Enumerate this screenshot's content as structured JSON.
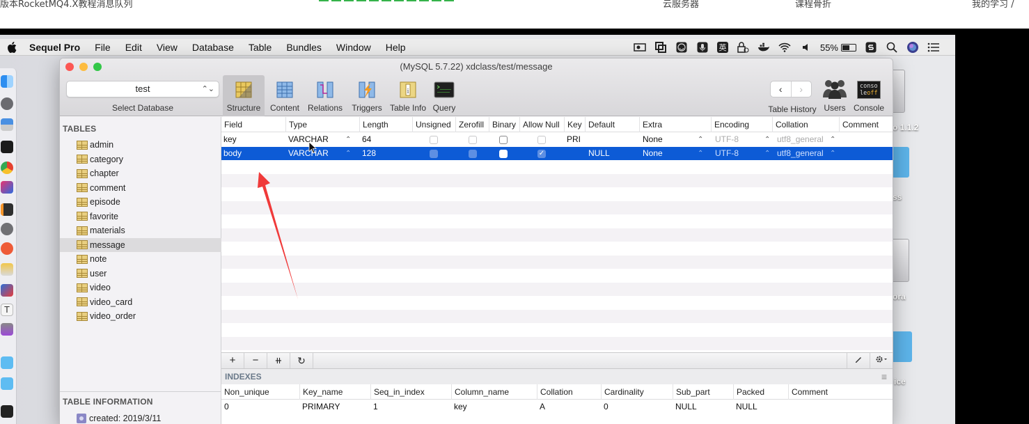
{
  "web_strip": {
    "left_text": "版本RocketMQ4.X教程消息队列",
    "nav": [
      "云服务器",
      "课程骨折",
      "我的学习 /"
    ]
  },
  "menubar": {
    "app_name": "Sequel Pro",
    "items": [
      "File",
      "Edit",
      "View",
      "Database",
      "Table",
      "Bundles",
      "Window",
      "Help"
    ],
    "status_icons": [
      "screen-record-icon",
      "screenshot-icon",
      "emoji-icon",
      "microphone-icon",
      "input-method-icon",
      "lock-icon",
      "docker-icon",
      "wifi-icon",
      "volume-icon"
    ],
    "input_method_label": "英",
    "battery_percent": "55%",
    "battery_level": 0.55
  },
  "window": {
    "title": "(MySQL 5.7.22) xdclass/test/message",
    "database_select": {
      "value": "test",
      "label": "Select Database"
    },
    "toolbar": [
      {
        "id": "structure",
        "label": "Structure",
        "active": true
      },
      {
        "id": "content",
        "label": "Content"
      },
      {
        "id": "relations",
        "label": "Relations"
      },
      {
        "id": "triggers",
        "label": "Triggers"
      },
      {
        "id": "tableinfo",
        "label": "Table Info"
      },
      {
        "id": "query",
        "label": "Query"
      }
    ],
    "right_toolbar": {
      "history_label": "Table History",
      "users_label": "Users",
      "console_label": "Console",
      "console_icon_text": [
        "conso",
        "le",
        "off"
      ]
    }
  },
  "sidebar": {
    "tables_header": "TABLES",
    "tables": [
      "admin",
      "category",
      "chapter",
      "comment",
      "episode",
      "favorite",
      "materials",
      "message",
      "note",
      "user",
      "video",
      "video_card",
      "video_order"
    ],
    "selected_table": "message",
    "info_header": "TABLE INFORMATION",
    "info_items": [
      "created: 2019/3/11"
    ]
  },
  "structure": {
    "columns": [
      "Field",
      "Type",
      "Length",
      "Unsigned",
      "Zerofill",
      "Binary",
      "Allow Null",
      "Key",
      "Default",
      "Extra",
      "Encoding",
      "Collation",
      "Comment"
    ],
    "rows": [
      {
        "field": "key",
        "type": "VARCHAR",
        "length": "64",
        "unsigned": false,
        "zerofill": false,
        "binary": false,
        "allow_null": false,
        "key": "PRI",
        "default": "",
        "extra": "None",
        "encoding": "UTF-8",
        "collation": "utf8_general",
        "comment": "",
        "selected": false
      },
      {
        "field": "body",
        "type": "VARCHAR",
        "length": "128",
        "unsigned": false,
        "zerofill": false,
        "binary": false,
        "allow_null": true,
        "key": "",
        "default": "NULL",
        "extra": "None",
        "encoding": "UTF-8",
        "collation": "utf8_general",
        "comment": "",
        "selected": true
      }
    ],
    "bottom_buttons": [
      "+",
      "−",
      "⧺",
      "↻"
    ]
  },
  "indexes": {
    "header": "INDEXES",
    "columns": [
      "Non_unique",
      "Key_name",
      "Seq_in_index",
      "Column_name",
      "Collation",
      "Cardinality",
      "Sub_part",
      "Packed",
      "Comment"
    ],
    "rows": [
      [
        "0",
        "PRIMARY",
        "1",
        "key",
        "A",
        "0",
        "NULL",
        "NULL",
        ""
      ]
    ]
  },
  "desktop_labels": [
    "o 1.1.2",
    "ss",
    "ora",
    "ice"
  ],
  "annotation": {
    "color": "#f03a3a"
  }
}
